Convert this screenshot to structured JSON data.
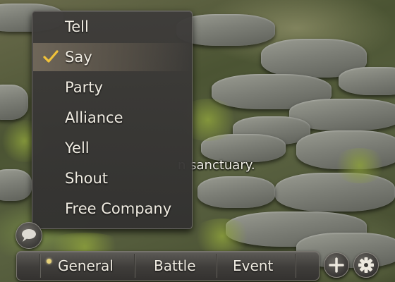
{
  "chat_mode_menu": {
    "items": [
      {
        "label": "Tell",
        "selected": false
      },
      {
        "label": "Say",
        "selected": true
      },
      {
        "label": "Party",
        "selected": false
      },
      {
        "label": "Alliance",
        "selected": false
      },
      {
        "label": "Yell",
        "selected": false
      },
      {
        "label": "Shout",
        "selected": false
      },
      {
        "label": "Free Company",
        "selected": false
      }
    ],
    "check_color": "#f0c23a"
  },
  "chat_log": {
    "visible_text": "n sanctuary."
  },
  "tabs": [
    {
      "label": "General",
      "active": true
    },
    {
      "label": "Battle",
      "active": false
    },
    {
      "label": "Event",
      "active": false
    }
  ],
  "icons": {
    "chat_mode": "speech-bubble-icon",
    "add_tab": "plus-icon",
    "settings": "gear-icon"
  }
}
